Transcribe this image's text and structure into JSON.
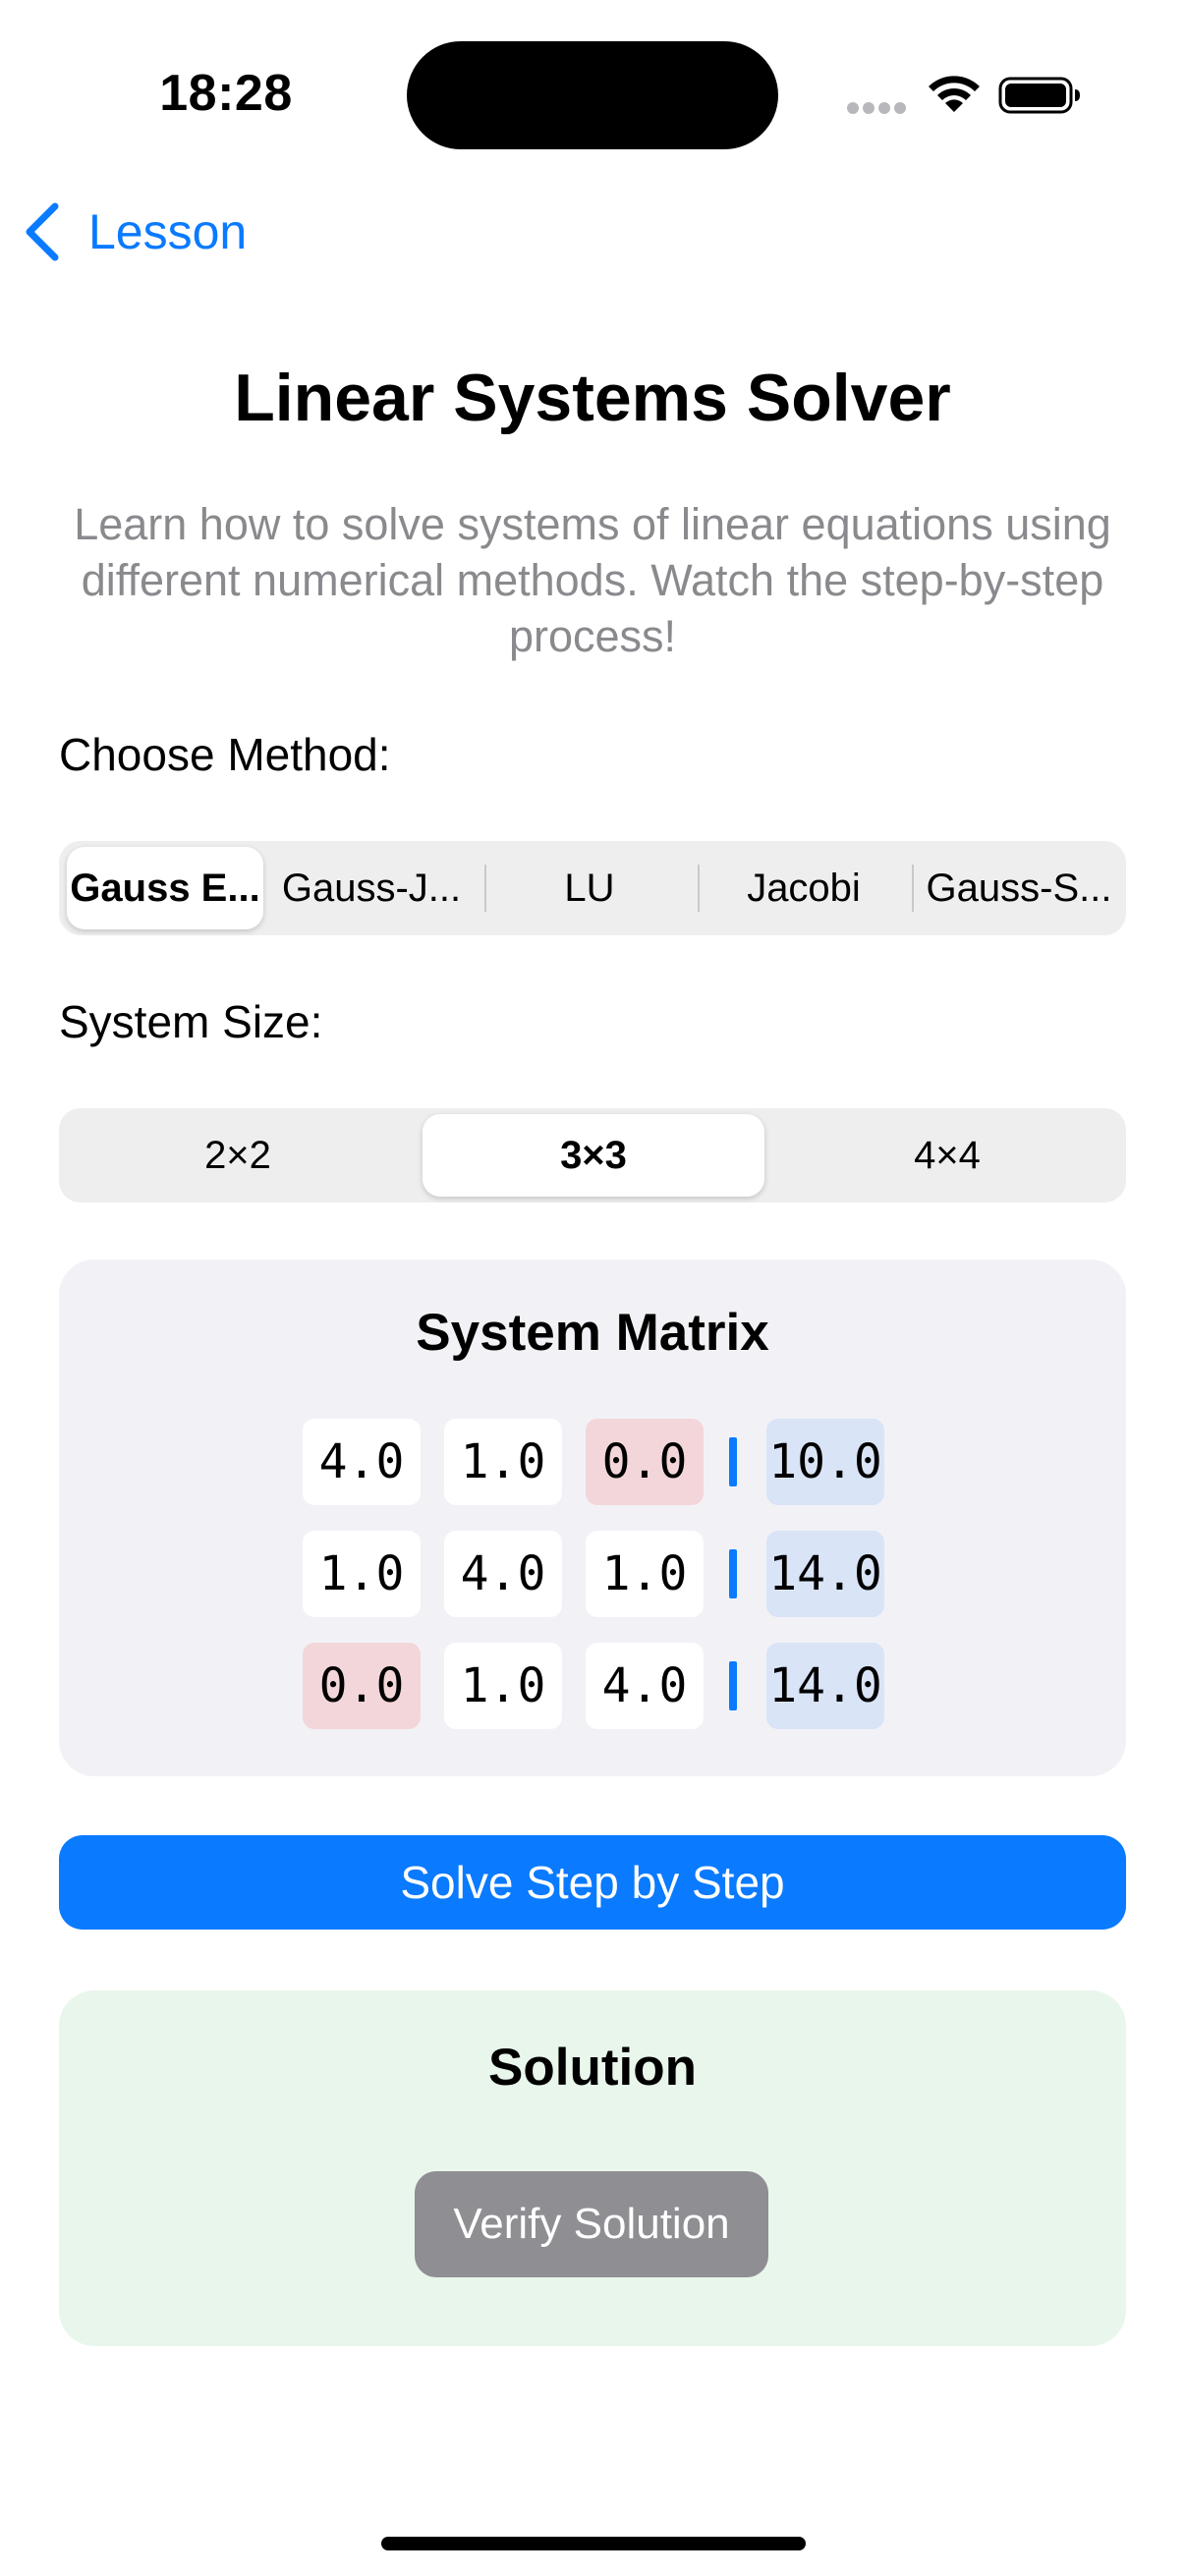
{
  "status_bar": {
    "time": "18:28"
  },
  "nav": {
    "back_label": "Lesson",
    "back_icon": "chevron-left-icon"
  },
  "header": {
    "title": "Linear Systems Solver",
    "description": "Learn how to solve systems of linear equations using different numerical methods. Watch the step-by-step process!"
  },
  "method": {
    "label": "Choose Method:",
    "options": [
      "Gauss E...",
      "Gauss-J...",
      "LU",
      "Jacobi",
      "Gauss-S..."
    ],
    "selected": "Gauss E..."
  },
  "size": {
    "label": "System Size:",
    "options": [
      "2×2",
      "3×3",
      "4×4"
    ],
    "selected": "3×3"
  },
  "matrix": {
    "title": "System Matrix",
    "rows": [
      {
        "coefficients": [
          "4.0",
          "1.0",
          "0.0"
        ],
        "rhs": "10.0"
      },
      {
        "coefficients": [
          "1.0",
          "4.0",
          "1.0"
        ],
        "rhs": "14.0"
      },
      {
        "coefficients": [
          "0.0",
          "1.0",
          "4.0"
        ],
        "rhs": "14.0"
      }
    ]
  },
  "actions": {
    "solve_label": "Solve Step by Step"
  },
  "solution": {
    "title": "Solution",
    "verify_label": "Verify Solution"
  },
  "colors": {
    "accent": "#0a7aff",
    "zero_cell": "#f3d6d9",
    "rhs_cell": "#d9e4f7",
    "solution_bg": "#e9f6ec",
    "verify_button": "#8e8e93"
  }
}
